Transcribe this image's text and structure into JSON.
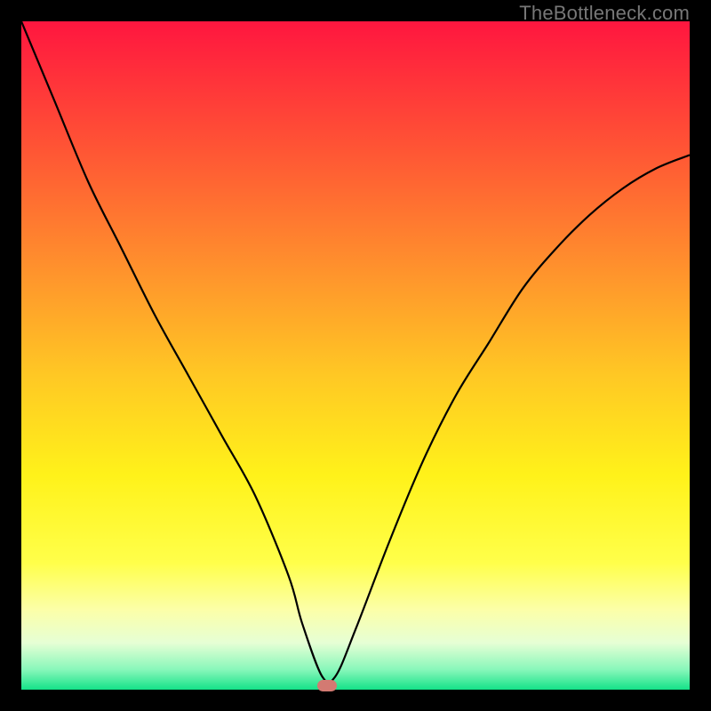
{
  "watermark": "TheBottleneck.com",
  "chart_data": {
    "type": "line",
    "title": "",
    "xlabel": "",
    "ylabel": "",
    "xlim": [
      0,
      1
    ],
    "ylim": [
      0,
      1
    ],
    "min_marker": {
      "x": 0.457,
      "y": 0.0
    },
    "series": [
      {
        "name": "bottleneck-curve",
        "x": [
          0.0,
          0.05,
          0.1,
          0.15,
          0.2,
          0.25,
          0.3,
          0.35,
          0.4,
          0.42,
          0.45,
          0.47,
          0.5,
          0.55,
          0.6,
          0.65,
          0.7,
          0.75,
          0.8,
          0.85,
          0.9,
          0.95,
          1.0
        ],
        "y": [
          1.0,
          0.88,
          0.76,
          0.66,
          0.56,
          0.47,
          0.38,
          0.29,
          0.17,
          0.1,
          0.02,
          0.02,
          0.09,
          0.22,
          0.34,
          0.44,
          0.52,
          0.6,
          0.66,
          0.71,
          0.75,
          0.78,
          0.8
        ]
      }
    ],
    "background_gradient": {
      "top": "#ff163f",
      "bottom": "#14e288"
    }
  }
}
